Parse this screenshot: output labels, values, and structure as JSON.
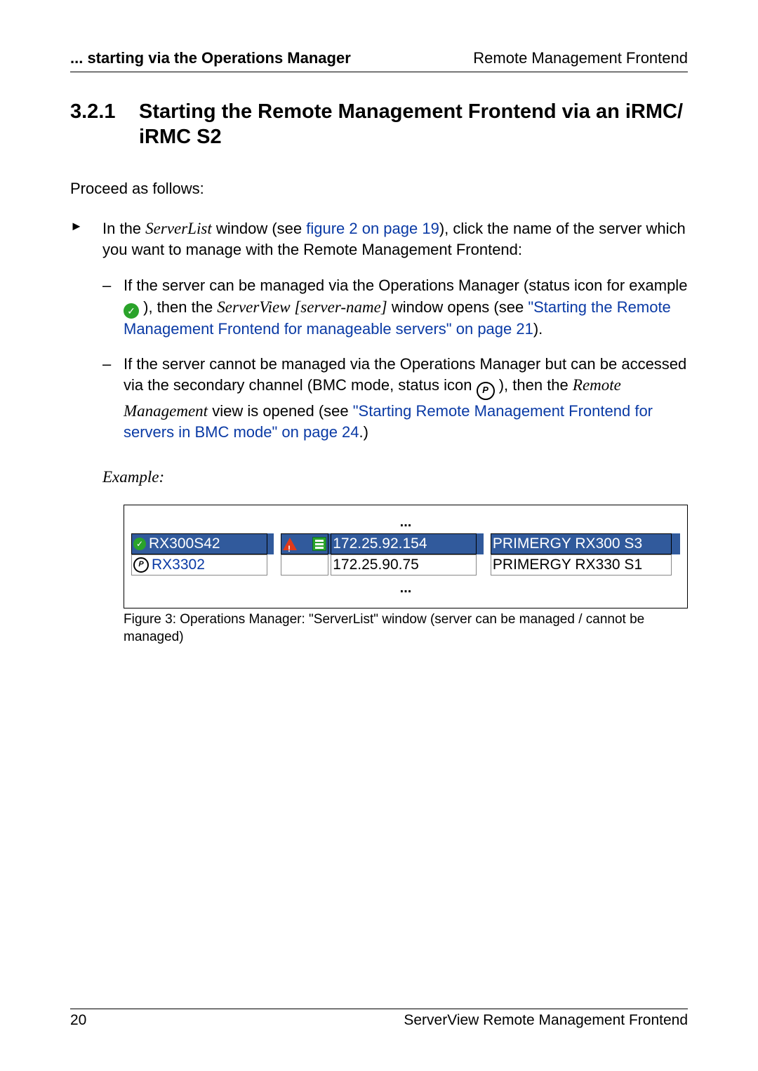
{
  "header": {
    "left": "... starting via the Operations Manager",
    "right": "Remote Management Frontend"
  },
  "section": {
    "number": "3.2.1",
    "title": "Starting the Remote Management Frontend via an iRMC/ iRMC S2"
  },
  "intro": "Proceed as follows:",
  "bullet": {
    "pre": "In the ",
    "serverlist": "ServerList",
    "mid1": " window (see ",
    "figref": "figure 2 on page 19",
    "post": "), click the name of the server which you want to manage with the Remote Management Frontend:"
  },
  "sub1": {
    "l1a": "If the server can be managed via the Operations Manager (status icon for example ",
    "l1b": " ), then the ",
    "svname": "ServerView [server-name]",
    "l1c": " window opens (see ",
    "link": "\"Starting the Remote Management Frontend for manageable servers\" on page 21",
    "l1d": ")."
  },
  "sub2": {
    "l1": "If the server cannot be managed via the Operations Manager but can be accessed via the secondary channel (BMC mode, status icon ",
    "l2a": " ), then the ",
    "rm": "Remote Management",
    "l2b": " view is opened (see ",
    "link": "\"Starting Remote Management Frontend for servers in BMC mode\" on page 24",
    "l2c": ".)"
  },
  "example_label": "Example:",
  "figure": {
    "dots": "...",
    "rows": [
      {
        "name": "RX300S42",
        "ip": "172.25.92.154",
        "model": "PRIMERGY RX300 S3"
      },
      {
        "name": "RX3302",
        "ip": "172.25.90.75",
        "model": "PRIMERGY RX330 S1"
      }
    ],
    "caption": "Figure 3: Operations Manager: \"ServerList\" window (server can be managed / cannot be managed)"
  },
  "footer": {
    "page": "20",
    "title": "ServerView Remote Management Frontend"
  }
}
